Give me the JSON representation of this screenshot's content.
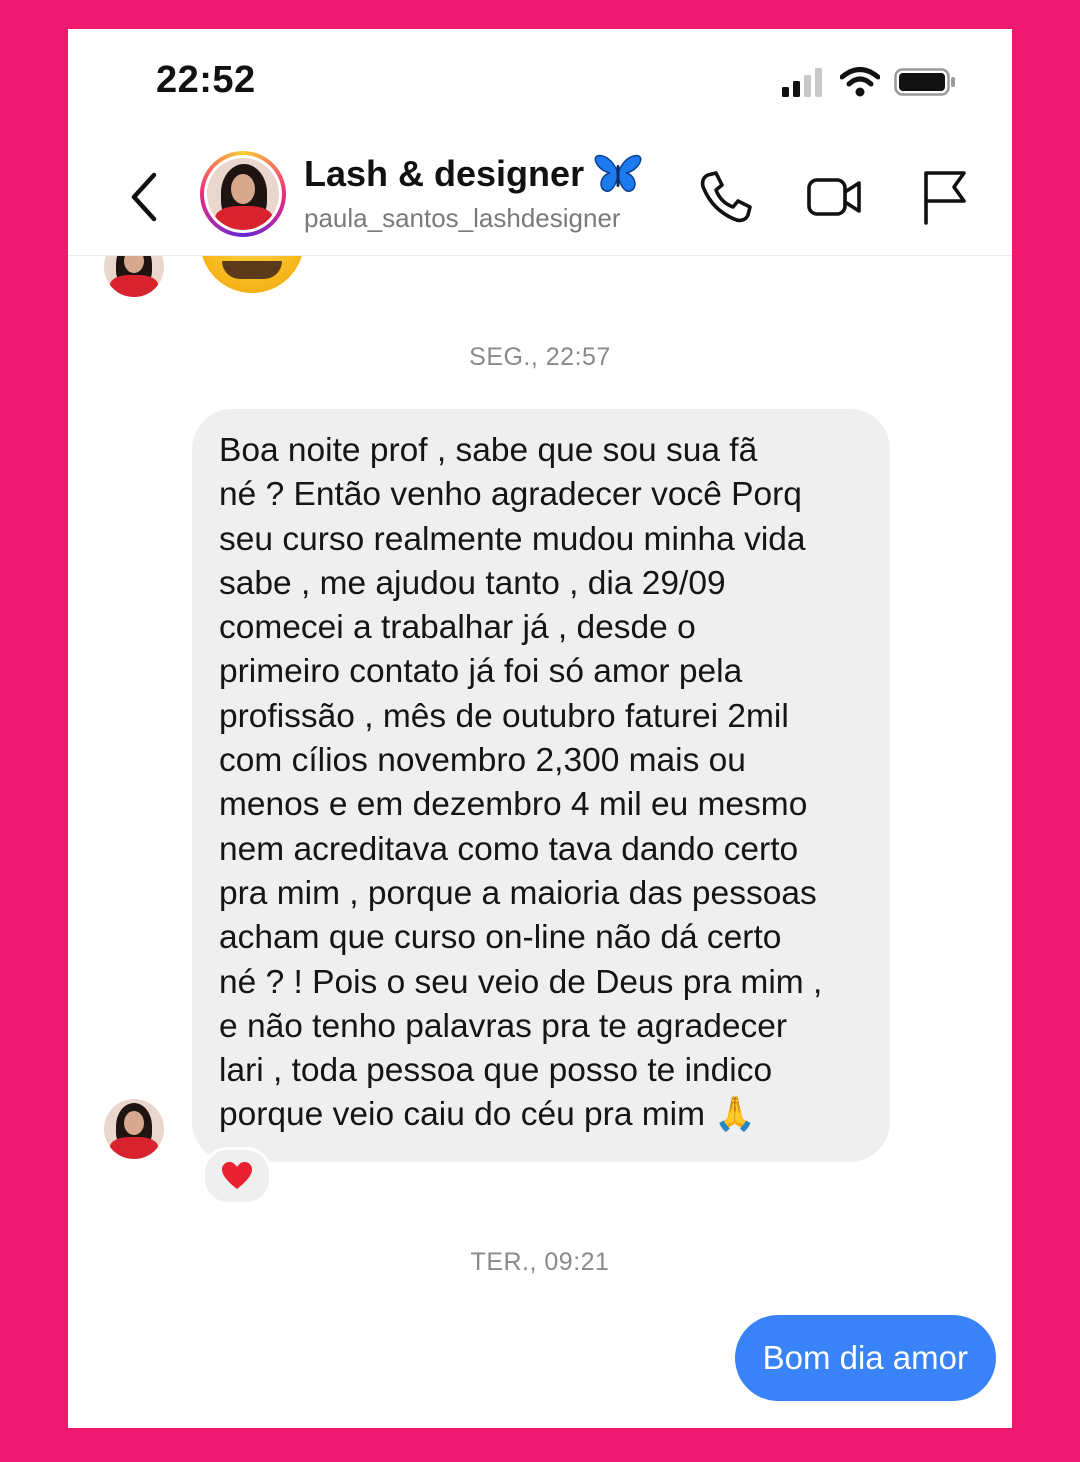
{
  "status_bar": {
    "time": "22:52"
  },
  "header": {
    "name": "Lash & designer",
    "name_emoji": "butterfly-emoji",
    "username": "paula_santos_lashdesigner",
    "icons": [
      "back-icon",
      "phone-icon",
      "video-icon",
      "flag-icon"
    ]
  },
  "chat": {
    "timestamp_1": "SEG., 22:57",
    "message_1": "Boa noite prof , sabe que sou sua fã\nné ? Então venho agradecer você Porq\nseu curso realmente mudou minha vida\nsabe , me ajudou tanto , dia 29/09\ncomecei a trabalhar já , desde o\nprimeiro contato já foi só amor pela\nprofissão , mês de outubro faturei 2mil\ncom cílios novembro 2,300 mais ou\nmenos e em dezembro 4 mil eu mesmo\nnem acreditava como tava dando certo\npra mim , porque a maioria das pessoas\nacham que curso on-line não dá certo\nné ? ! Pois o seu veio de Deus pra mim ,\ne não tenho palavras pra te agradecer\nlari , toda pessoa que posso te indico\nporque veio caiu do céu pra mim ",
    "message_1_emoji": "🙏",
    "reaction": "heart-emoji",
    "timestamp_2": "TER., 09:21",
    "message_2": "Bom dia amor"
  },
  "colors": {
    "background_frame": "#ee1a6f",
    "incoming_bubble": "#efefef",
    "outgoing_bubble": "#3a82f7",
    "butterfly": "#1d7bf0"
  }
}
